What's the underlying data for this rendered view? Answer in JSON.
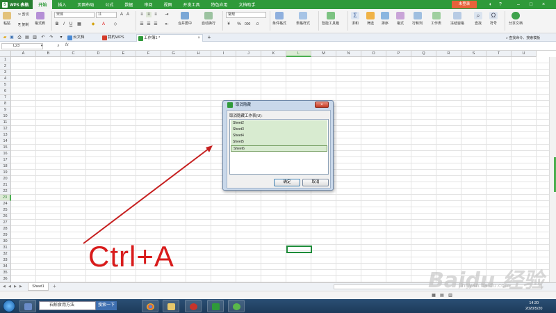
{
  "app": {
    "name": "WPS 表格",
    "login_label": "未登录",
    "menu": [
      "开始",
      "插入",
      "页面布局",
      "公式",
      "数据",
      "审阅",
      "视图",
      "开发工具",
      "特色应用",
      "文档助手"
    ],
    "active_menu": "开始"
  },
  "ribbon": {
    "paste": "粘贴",
    "cut": "剪切",
    "copy": "复制",
    "format_painter": "格式刷",
    "font_name": "宋体",
    "font_size": "11",
    "number_format": "常规",
    "merge_center": "合并居中",
    "wrap_text": "自动换行",
    "conditional_format": "条件格式",
    "table_style": "表格样式",
    "smart_toolbox": "智能工具箱",
    "sum": "求和",
    "filter": "筛选",
    "sort": "排序",
    "format": "格式",
    "row_col": "行和列",
    "worksheet": "工作表",
    "freeze": "冻结窗格",
    "find": "查找",
    "symbol": "符号",
    "share": "分享文档",
    "search_hint": "查找命令、搜索模板"
  },
  "tabs": [
    {
      "label": "云文档"
    },
    {
      "label": "我的WPS"
    },
    {
      "label": "工作簿1 *"
    }
  ],
  "formula_bar": {
    "cell_ref": "L23",
    "fx": "fx"
  },
  "columns": [
    "A",
    "B",
    "C",
    "D",
    "E",
    "F",
    "G",
    "H",
    "I",
    "J",
    "K",
    "L",
    "M",
    "N",
    "O",
    "P",
    "Q",
    "R",
    "S",
    "T",
    "U"
  ],
  "selected_column": "L",
  "rows": [
    "1",
    "2",
    "3",
    "4",
    "5",
    "6",
    "7",
    "8",
    "9",
    "10",
    "11",
    "12",
    "13",
    "14",
    "15",
    "16",
    "17",
    "18",
    "19",
    "20",
    "21",
    "22",
    "23",
    "24",
    "25",
    "26",
    "27",
    "28",
    "29",
    "30",
    "31",
    "32",
    "33",
    "34",
    "35",
    "36"
  ],
  "selected_row": "23",
  "sheet_tab": "Sheet1",
  "dialog": {
    "title": "取消隐藏",
    "label": "取消隐藏工作表(U):",
    "items": [
      "Sheet2",
      "Sheet3",
      "Sheet4",
      "Sheet5",
      "Sheet6"
    ],
    "ok": "确定",
    "cancel": "取消"
  },
  "taskbar": {
    "search_text": "石斛食用方法",
    "search_button": "搜索一下",
    "time": "14:20",
    "date": "2020/5/20"
  },
  "annotation": {
    "text": "Ctrl+A",
    "color": "#d81b1b"
  },
  "watermark": {
    "brand": "Baidu 经验",
    "url": "jingyan.baidu.com"
  },
  "colors": {
    "accent_green": "#2f9a3a",
    "selection_border": "#1e8c3a"
  }
}
